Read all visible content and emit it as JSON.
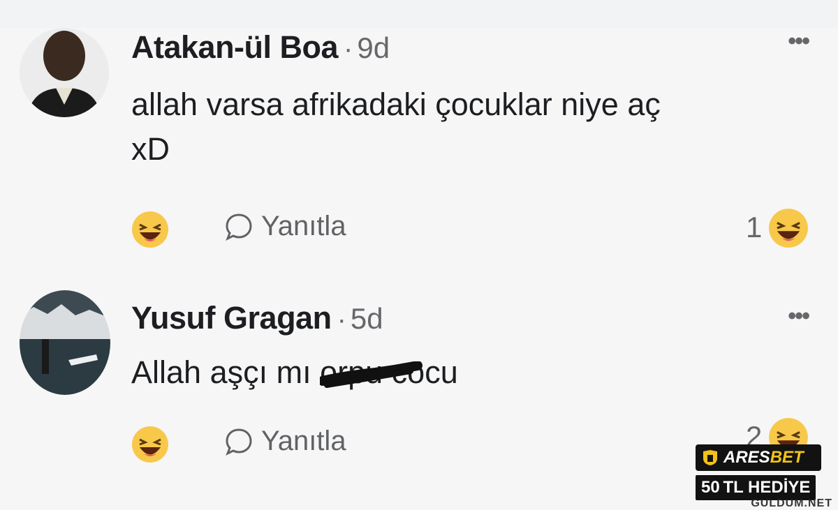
{
  "comments": [
    {
      "author": "Atakan-ül Boa",
      "time": "9d",
      "text_line1": "allah varsa afrikadaki çocuklar niye aç",
      "text_line2": "xD",
      "reply_label": "Yanıtla",
      "reaction_count": "1",
      "reaction_icon": "laughing-emoji"
    },
    {
      "author": "Yusuf Gragan",
      "time": "5d",
      "text_before": "Allah aşçı mı ",
      "text_censored": "or",
      "text_after": "pu cocu",
      "reply_label": "Yanıtla",
      "reaction_count": "2",
      "reaction_icon": "laughing-emoji"
    }
  ],
  "separator_dot": "·",
  "more_label": "•••",
  "brand": {
    "name_part1": "ARES",
    "name_part2": "BET",
    "promo": "50 TL HEDİYE"
  },
  "watermark": "GULDUM.NET",
  "colors": {
    "background": "#f6f6f6",
    "secondary_text": "#65676b",
    "brand_gold": "#f2c21b"
  }
}
